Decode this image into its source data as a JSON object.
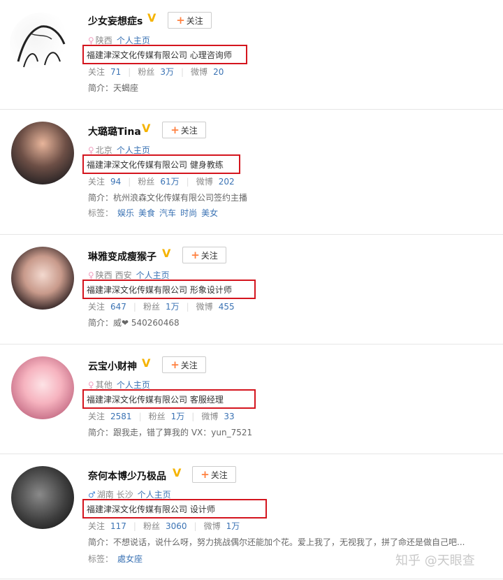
{
  "follow_label": "关注",
  "stats_labels": {
    "following": "关注",
    "fans": "粉丝",
    "weibo": "微博"
  },
  "intro_label": "简介：",
  "tags_label": "标签：",
  "homepage_label": "个人主页",
  "users": [
    {
      "name": "少女妄想症s",
      "gender": "female",
      "location": "陕西",
      "company": "福建津深文化传媒有限公司 心理咨询师",
      "following": "71",
      "fans": "3万",
      "weibo": "20",
      "intro": "天蝎座"
    },
    {
      "name": "大璐璐Tina",
      "gender": "female",
      "location": "北京",
      "company": "福建津深文化传媒有限公司 健身教练",
      "following": "94",
      "fans": "61万",
      "weibo": "202",
      "intro": "杭州浪森文化传媒有限公司签约主播",
      "tags": [
        "娱乐",
        "美食",
        "汽车",
        "时尚",
        "美女"
      ]
    },
    {
      "name": "琳雅变成瘦猴子",
      "gender": "female",
      "location": "陕西 西安",
      "company": "福建津深文化传媒有限公司 形象设计师",
      "following": "647",
      "fans": "1万",
      "weibo": "455",
      "intro": "威❤ 540260468"
    },
    {
      "name": "云宝小财神",
      "gender": "female",
      "location": "其他",
      "company": "福建津深文化传媒有限公司 客服经理",
      "following": "2581",
      "fans": "1万",
      "weibo": "33",
      "intro": "跟我走，错了算我的 VX：yun_7521"
    },
    {
      "name": "奈何本博少乃极品",
      "gender": "male",
      "location": "湖南 长沙",
      "company": "福建津深文化传媒有限公司 设计师",
      "following": "117",
      "fans": "3060",
      "weibo": "1万",
      "intro": "不想说话，说什么呀，努力挑战偶尔还能加个花。爱上我了，无视我了，拼了命还是做自己吧...",
      "tags": [
        "處女座"
      ]
    }
  ],
  "watermark": "知乎 @天眼查"
}
